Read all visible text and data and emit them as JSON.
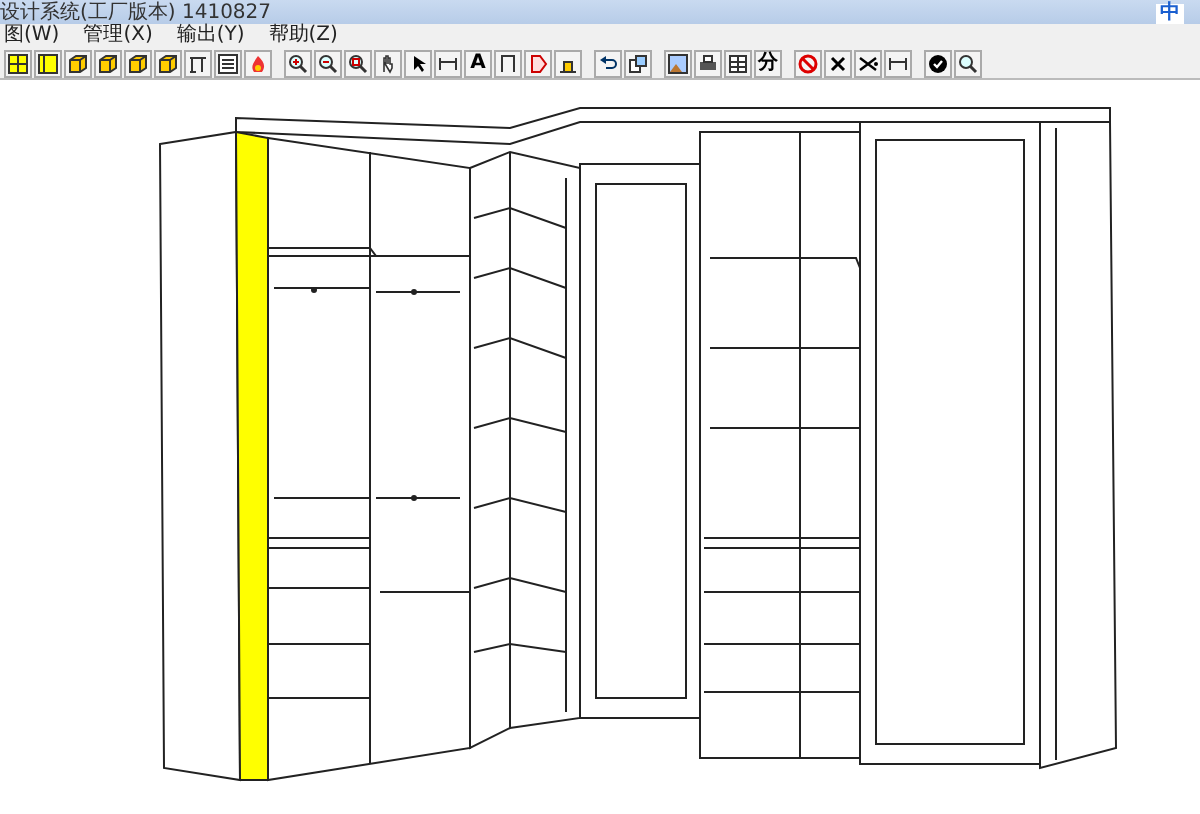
{
  "window": {
    "title": "设计系统(工厂版本)  1410827",
    "ime_indicator": "中"
  },
  "menu": [
    "图(W)",
    "管理(X)",
    "输出(Y)",
    "帮助(Z)"
  ],
  "toolbar": [
    [
      {
        "kind": "icon"
      },
      {
        "kind": "icon"
      },
      {
        "kind": "icon"
      },
      {
        "kind": "icon"
      },
      {
        "kind": "icon"
      },
      {
        "kind": "icon"
      },
      {
        "kind": "icon"
      },
      {
        "kind": "icon"
      },
      {
        "kind": "icon"
      }
    ],
    [
      {
        "kind": "icon"
      },
      {
        "kind": "icon"
      },
      {
        "kind": "icon"
      },
      {
        "kind": "icon"
      },
      {
        "kind": "icon"
      },
      {
        "kind": "icon"
      },
      {
        "kind": "text",
        "label": "A"
      },
      {
        "kind": "icon"
      },
      {
        "kind": "icon"
      },
      {
        "kind": "icon"
      }
    ],
    [
      {
        "kind": "icon"
      },
      {
        "kind": "icon"
      }
    ],
    [
      {
        "kind": "icon"
      },
      {
        "kind": "icon"
      },
      {
        "kind": "icon"
      },
      {
        "kind": "text",
        "label": "分"
      }
    ],
    [
      {
        "kind": "icon"
      },
      {
        "kind": "icon"
      },
      {
        "kind": "icon"
      },
      {
        "kind": "icon"
      }
    ],
    [
      {
        "kind": "icon"
      },
      {
        "kind": "icon"
      }
    ]
  ]
}
